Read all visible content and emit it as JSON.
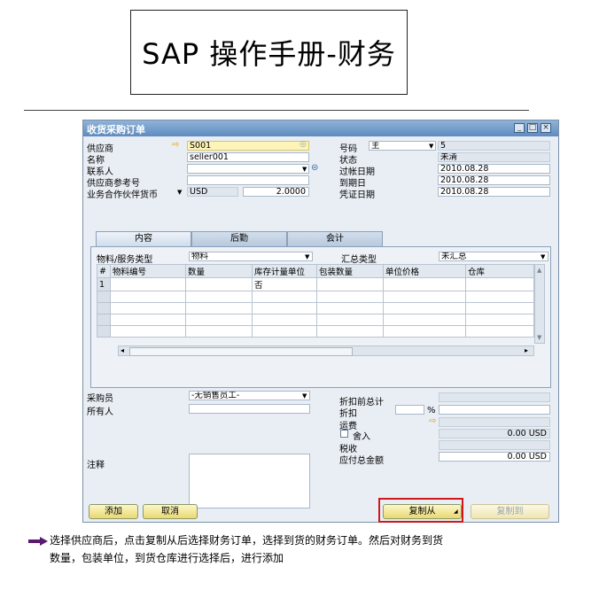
{
  "doc_title": "SAP 操作手册-财务",
  "window": {
    "title": "收货采购订单",
    "header_left": [
      {
        "label": "供应商",
        "value": "S001"
      },
      {
        "label": "名称",
        "value": "seller001"
      },
      {
        "label": "联系人",
        "value": ""
      },
      {
        "label": "供应商参考号",
        "value": ""
      }
    ],
    "currency": {
      "label": "业务合作伙伴货币",
      "code": "USD",
      "rate": "2.0000"
    },
    "header_right": {
      "number_label": "号码",
      "series": "主",
      "number": "5",
      "status_label": "状态",
      "status": "未清",
      "posting_label": "过帐日期",
      "posting": "2010.08.28",
      "due_label": "到期日",
      "due": "2010.08.28",
      "doc_date_label": "凭证日期",
      "doc_date": "2010.08.28"
    },
    "tabs": [
      "内容",
      "后勤",
      "会计"
    ],
    "item_type_label": "物料/服务类型",
    "item_type": "物料",
    "summary_type_label": "汇总类型",
    "summary_type": "未汇总",
    "columns": [
      "#",
      "物料编号",
      "数量",
      "库存计量单位",
      "包装数量",
      "单位价格",
      "仓库"
    ],
    "rows": [
      [
        "1",
        "",
        "",
        "否",
        "",
        "",
        ""
      ]
    ],
    "buyer_label": "采购员",
    "buyer": "-无销售员工-",
    "owner_label": "所有人",
    "owner": "",
    "remarks_label": "注释",
    "totals": {
      "before_discount_label": "折扣前总计",
      "discount_label": "折扣",
      "percent": "%",
      "freight_label": "运费",
      "rounding_label": "舍入",
      "rounding_value": "0.00 USD",
      "tax_label": "税收",
      "total_label": "应付总金额",
      "total_value": "0.00 USD"
    },
    "buttons": {
      "add": "添加",
      "cancel": "取消",
      "copy_from": "复制从",
      "copy_to": "复制到"
    }
  },
  "caption_line1": "选择供应商后，点击复制从后选择财务订单，选择到货的财务订单。然后对财务到货",
  "caption_line2": "数量，包装单位，到货仓库进行选择后，进行添加",
  "colors": {
    "accent_red": "#d01818",
    "arrow_purple": "#5a1a6e",
    "window_bg": "#e9eef4"
  }
}
